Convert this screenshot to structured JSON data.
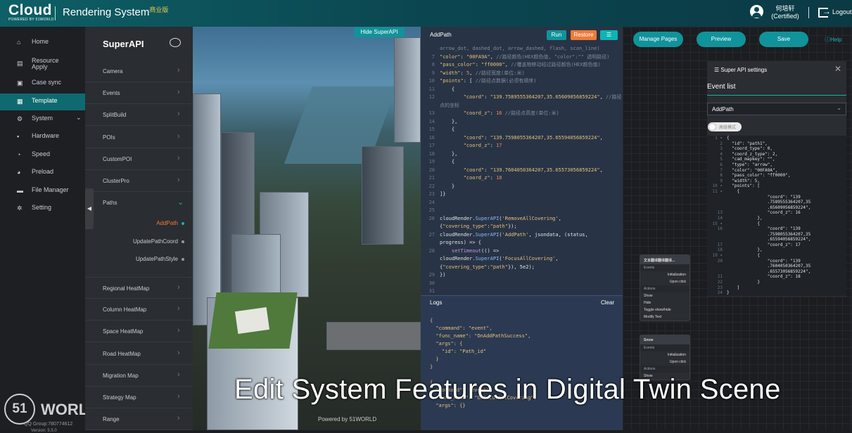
{
  "header": {
    "logo": "Cloud",
    "logo_sub": "POWERED BY 51WORLD",
    "system": "Rendering System",
    "edition": "商业版",
    "user_name": "何培轩",
    "user_role": "(Certified)",
    "logout": "Logout"
  },
  "nav": [
    {
      "label": "Home",
      "icon": "home-icon"
    },
    {
      "label": "Resource Apply",
      "icon": "resource-icon"
    },
    {
      "label": "Case sync",
      "icon": "case-icon"
    },
    {
      "label": "Template",
      "icon": "template-icon"
    },
    {
      "label": "System",
      "icon": "system-icon"
    },
    {
      "label": "Hardware",
      "icon": "hardware-icon"
    },
    {
      "label": "Speed",
      "icon": "speed-icon"
    },
    {
      "label": "Preload",
      "icon": "preload-icon"
    },
    {
      "label": "File Manager",
      "icon": "folder-icon"
    },
    {
      "label": "Setting",
      "icon": "gear-icon"
    }
  ],
  "watermark": {
    "logo": "51",
    "word": "WORLD",
    "qq": "QQ Group:780774612",
    "version": "Version: 5.5.0"
  },
  "api": {
    "title": "SuperAPI",
    "items": [
      "Camera",
      "Events",
      "SplitBuild",
      "POIs",
      "CustomPOI",
      "ClusterPro",
      "Paths"
    ],
    "subs": [
      "AddPath",
      "UpdatePathCoord",
      "UpdatePathStyle"
    ],
    "items2": [
      "Regional HeatMap",
      "Column HeatMap",
      "Space HeatMap",
      "Road HeatMap",
      "Migration Map",
      "Strategy Map",
      "Range"
    ]
  },
  "scene": {
    "hide_button": "Hide SuperAPI",
    "powered": "Powered by 51WORLD"
  },
  "editor": {
    "title": "AddPath",
    "run": "Run",
    "restore": "Restore",
    "format": "☰"
  },
  "logs": {
    "title": "Logs",
    "clear": "Clear"
  },
  "toolbar": {
    "manage": "Manage Pages",
    "preview": "Preview",
    "save": "Save",
    "help": "Help"
  },
  "nodes": [
    {
      "title": "文本翻译翻译翻译...",
      "events": "Events",
      "e1": "Initialization",
      "e2": "Upon click",
      "actions": "Actions",
      "a1": "Show",
      "a2": "Hide",
      "a3": "Toggle show/hide",
      "a4": "Modify Text"
    },
    {
      "title": "Snow",
      "events": "Events",
      "e1": "Initialization",
      "e2": "Upon click",
      "actions": "Actions",
      "a1": "Show"
    }
  ],
  "settings": {
    "title": "Super API settings",
    "event_list": "Event list",
    "selected": "AddPath",
    "toggle": "高级模式"
  },
  "caption": "Edit System Features in Digital Twin Scene"
}
